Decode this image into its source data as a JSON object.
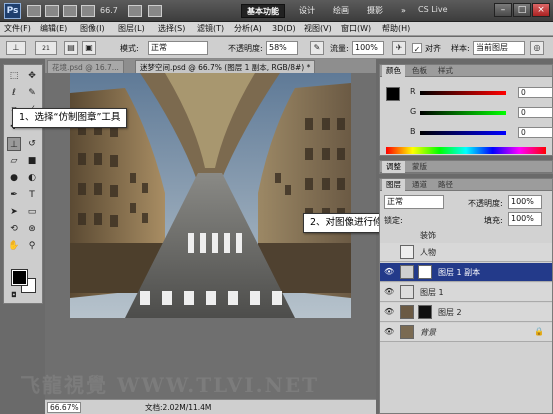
{
  "titlebar": {
    "logo": "Ps",
    "zoom": "66.7",
    "workspaces": [
      "基本功能",
      "设计",
      "绘画",
      "摄影"
    ],
    "more": "»",
    "cslive": "CS Live"
  },
  "menu": [
    "文件(F)",
    "编辑(E)",
    "图像(I)",
    "图层(L)",
    "选择(S)",
    "滤镜(T)",
    "分析(A)",
    "3D(D)",
    "视图(V)",
    "窗口(W)",
    "帮助(H)"
  ],
  "options": {
    "brush_size": "21",
    "mode_label": "模式:",
    "mode_value": "正常",
    "opacity_label": "不透明度:",
    "opacity_value": "58%",
    "flow_label": "流量:",
    "flow_value": "100%",
    "aligned_label": "对齐",
    "sample_label": "样本:",
    "sample_value": "当前图层"
  },
  "doc_tabs": [
    "花境.psd @ 16.7...",
    "迷梦空间.psd @ 66.7% (图层 1 副本, RGB/8#) *"
  ],
  "status": {
    "zoom": "66.67%",
    "doc_info": "文档:2.02M/11.4M"
  },
  "callouts": {
    "step1": "1、选择“仿制图章”工具",
    "step2": "2、对图像进行修整涂抹"
  },
  "color_panel": {
    "tabs": [
      "颜色",
      "色板",
      "样式"
    ],
    "channels": [
      {
        "label": "R",
        "value": "0"
      },
      {
        "label": "G",
        "value": "0"
      },
      {
        "label": "B",
        "value": "0"
      }
    ]
  },
  "adjust_panel": {
    "tabs": [
      "调整",
      "蒙版"
    ]
  },
  "layers_panel": {
    "tabs": [
      "图层",
      "通道",
      "路径"
    ],
    "blend_mode": "正常",
    "opacity_label": "不透明度:",
    "opacity_value": "100%",
    "lock_label": "锁定:",
    "fill_label": "填充:",
    "fill_value": "100%",
    "group_name": "装饰",
    "layers": [
      {
        "name": "人物",
        "selected": false
      },
      {
        "name": "图层 1 副本",
        "selected": true
      },
      {
        "name": "图层 1",
        "selected": false
      },
      {
        "name": "图层 2",
        "selected": false
      },
      {
        "name": "背景",
        "selected": false
      }
    ]
  },
  "watermark": "飞龍視覺 WWW.TLVI.NET"
}
